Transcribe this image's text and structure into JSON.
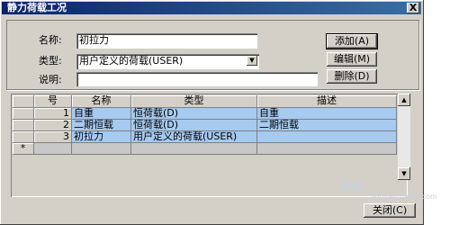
{
  "window": {
    "title": "静力荷载工况",
    "close_glyph": "X"
  },
  "form": {
    "name_label": "名称:",
    "name_value": "初拉力",
    "type_label": "类型:",
    "type_value": "用户定义的荷载(USER)",
    "desc_label": "说明:",
    "desc_value": ""
  },
  "buttons": {
    "add": "添加(A)",
    "edit": "编辑(M)",
    "delete": "删除(D)",
    "close": "关闭(C)"
  },
  "table": {
    "headers": [
      "号",
      "名称",
      "类型",
      "描述"
    ],
    "rows": [
      {
        "num": "1",
        "name": "自重",
        "type": "恒荷载(D)",
        "desc": "自重"
      },
      {
        "num": "2",
        "name": "二期恒载",
        "type": "恒荷载(D)",
        "desc": "二期恒载"
      },
      {
        "num": "3",
        "name": "初拉力",
        "type": "用户定义的荷载(USER)",
        "desc": ""
      }
    ],
    "new_row_marker": "*"
  },
  "icons": {
    "combo_arrow": "triangle-down",
    "scroll_up": "triangle-up",
    "scroll_down": "triangle-down"
  },
  "watermark": {
    "text": "Bai",
    "sub": "jingyan.baidu.com"
  }
}
